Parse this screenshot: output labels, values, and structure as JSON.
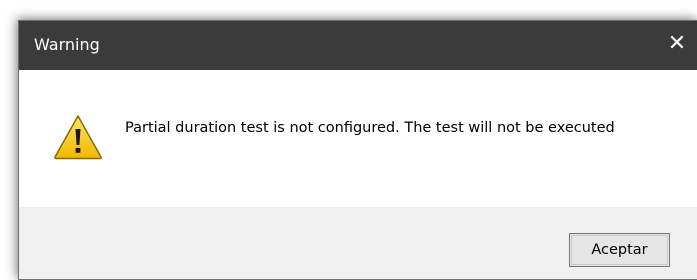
{
  "dialog": {
    "title": "Warning",
    "close_glyph": "✕",
    "icon": "warning-icon",
    "message": "Partial duration test is not configured. The test will not be executed",
    "accept_label": "Aceptar"
  },
  "colors": {
    "titlebar": "#3b3b3b",
    "title_text": "#ffffff",
    "footer": "#f0f0f0",
    "warning_yellow": "#f7c800",
    "warning_outline": "#8a6a00"
  }
}
